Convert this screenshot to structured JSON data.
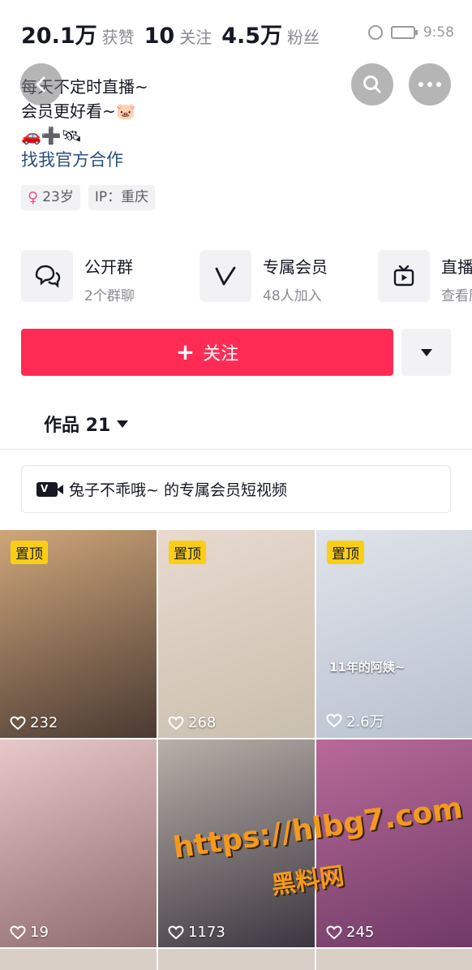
{
  "stats": [
    {
      "value": "20.1万",
      "label": "获赞"
    },
    {
      "value": "10",
      "label": "关注"
    },
    {
      "value": "4.5万",
      "label": "粉丝"
    }
  ],
  "status_bar": {
    "time": "9:58"
  },
  "bio": {
    "line1": "每天不定时直播~",
    "line2": "会员更好看~🐷",
    "line3": "🚗➕🛰",
    "link": "找我官方合作"
  },
  "tags": {
    "age": "23岁",
    "ip": "IP：重庆"
  },
  "features": [
    {
      "title": "公开群",
      "sub": "2个群聊",
      "icon": "chat-bubbles-icon"
    },
    {
      "title": "专属会员",
      "sub": "48人加入",
      "icon": "v-badge-icon"
    },
    {
      "title": "直播动态",
      "sub": "查看历史",
      "icon": "tv-play-icon"
    }
  ],
  "follow": {
    "label": "关注"
  },
  "works_tab": {
    "label": "作品 21"
  },
  "member_bar": {
    "text": "兔子不乖哦~ 的专属会员短视频"
  },
  "videos": [
    {
      "pinned": "置顶",
      "likes": "232",
      "caption": "",
      "colors": [
        "#cfa67a",
        "#4a3a32"
      ]
    },
    {
      "pinned": "置顶",
      "likes": "268",
      "caption": "",
      "colors": [
        "#e9d9cf",
        "#c9bfae"
      ]
    },
    {
      "pinned": "置顶",
      "likes": "2.6万",
      "caption": "11年的阿姨~",
      "colors": [
        "#dfe3ea",
        "#b9c1cf"
      ]
    },
    {
      "pinned": "",
      "likes": "19",
      "caption": "",
      "colors": [
        "#e8c8c8",
        "#8e6b6d"
      ]
    },
    {
      "pinned": "",
      "likes": "1173",
      "caption": "",
      "colors": [
        "#b9b0a8",
        "#3b3540"
      ]
    },
    {
      "pinned": "",
      "likes": "245",
      "caption": "",
      "colors": [
        "#b86a9a",
        "#6f3a66"
      ]
    }
  ],
  "watermark": {
    "url": "https://hlbg7.com",
    "sub": "黑料网"
  }
}
